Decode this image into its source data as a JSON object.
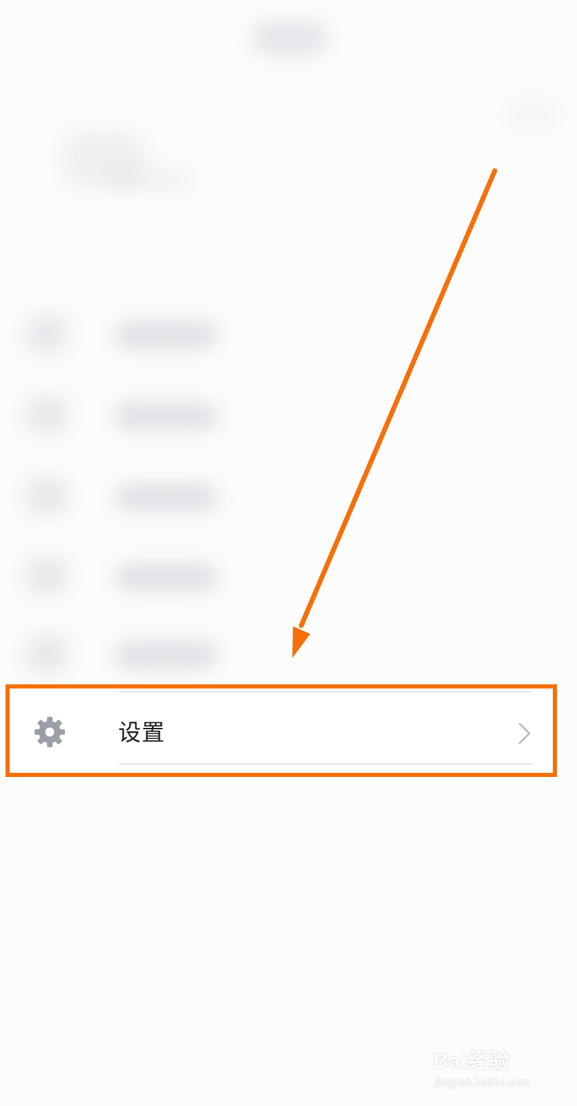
{
  "settings_item": {
    "label": "设置",
    "icon": "gear-icon",
    "chevron_icon": "chevron-right-icon"
  },
  "annotation": {
    "highlight_color": "#f57009"
  },
  "watermark": {
    "brand": "Bai经验",
    "url": "jingyan.baidu.com"
  }
}
